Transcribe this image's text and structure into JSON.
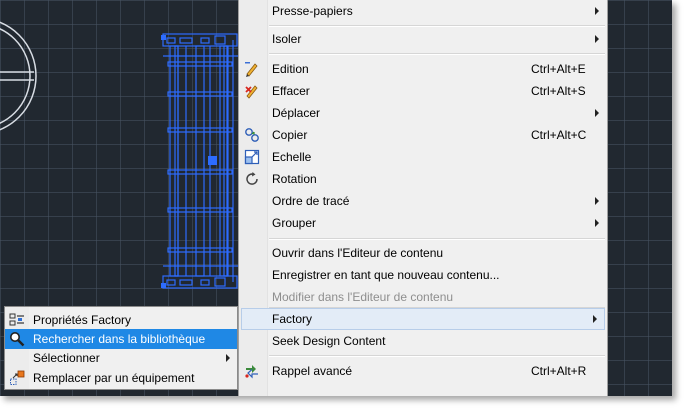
{
  "context_menu": {
    "items": [
      {
        "label": "Presse-papiers",
        "submenu": true
      },
      {
        "label": "Isoler",
        "submenu": true
      },
      {
        "label": "Edition",
        "shortcut": "Ctrl+Alt+E",
        "icon": "edit-pencil-icon"
      },
      {
        "label": "Effacer",
        "shortcut": "Ctrl+Alt+S",
        "icon": "erase-icon"
      },
      {
        "label": "Déplacer",
        "submenu": true
      },
      {
        "label": "Copier",
        "shortcut": "Ctrl+Alt+C",
        "icon": "copy-icon"
      },
      {
        "label": "Echelle",
        "icon": "scale-icon"
      },
      {
        "label": "Rotation",
        "icon": "rotate-icon"
      },
      {
        "label": "Ordre de tracé",
        "submenu": true
      },
      {
        "label": "Grouper",
        "submenu": true
      },
      {
        "label": "Ouvrir dans l'Editeur de contenu"
      },
      {
        "label": "Enregistrer en tant que nouveau contenu..."
      },
      {
        "label": "Modifier dans l'Editeur de contenu",
        "disabled": true
      },
      {
        "label": "Factory",
        "submenu": true,
        "highlighted": true
      },
      {
        "label": "Seek Design Content"
      },
      {
        "label": "Rappel avancé",
        "shortcut": "Ctrl+Alt+R",
        "icon": "advanced-recall-icon"
      }
    ]
  },
  "factory_submenu": {
    "items": [
      {
        "label": "Propriétés Factory",
        "icon": "properties-icon"
      },
      {
        "label": "Rechercher dans la bibliothèque",
        "icon": "search-icon",
        "highlighted": true
      },
      {
        "label": "Sélectionner",
        "submenu": true
      },
      {
        "label": "Remplacer par un équipement",
        "icon": "replace-equipment-icon"
      }
    ]
  },
  "colors": {
    "canvas_bg": "#212830",
    "selection_blue": "#2d6cff",
    "menu_bg": "#f0f0f0",
    "highlight": "#1f88e5"
  }
}
